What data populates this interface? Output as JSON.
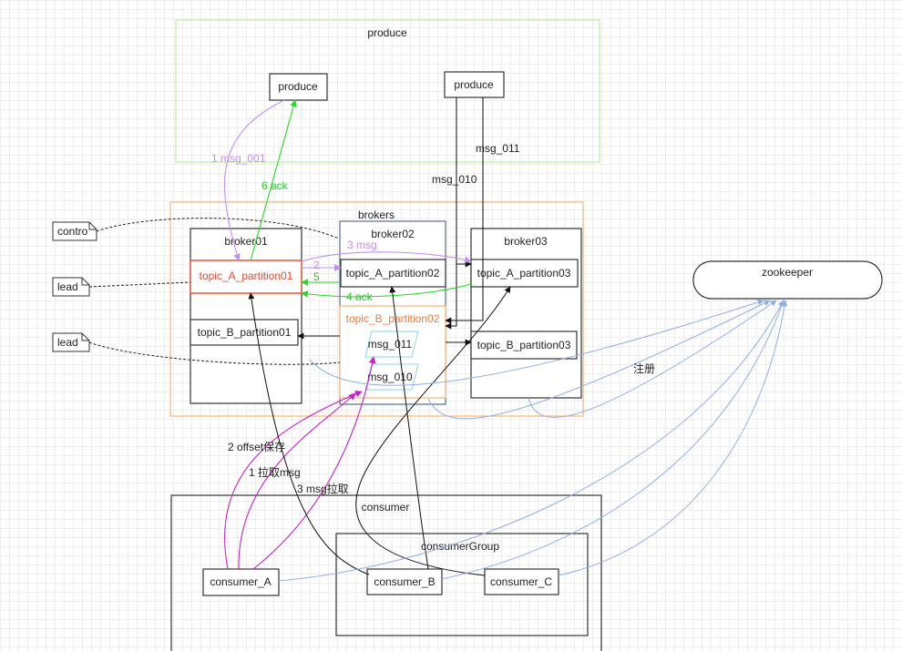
{
  "produce_group": {
    "title": "produce"
  },
  "producers": {
    "left": "produce",
    "right": "produce"
  },
  "brokers": {
    "title": "brokers",
    "broker01": {
      "title": "broker01",
      "partition_a": "topic_A_partition01",
      "partition_b": "topic_B_partition01"
    },
    "broker02": {
      "title": "broker02",
      "partition_a": "topic_A_partition02",
      "partition_b": "topic_B_partition02",
      "msgs": [
        "msg_011",
        "msg_010"
      ]
    },
    "broker03": {
      "title": "broker03",
      "partition_a": "topic_A_partition03",
      "partition_b": "topic_B_partition03"
    }
  },
  "notes": {
    "contro": "contro",
    "lead1": "lead",
    "lead2": "lead"
  },
  "zookeeper": {
    "title": "zookeeper"
  },
  "consumer": {
    "title": "consumer",
    "group_title": "consumerGroup",
    "consumer_a": "consumer_A",
    "consumer_b": "consumer_B",
    "consumer_c": "consumer_C"
  },
  "edge_labels": {
    "msg_001": "1 msg_001",
    "ack6": "6 ack",
    "msg_010": "msg_010",
    "msg_011": "msg_011",
    "msg3": "3 msg",
    "step2": "2",
    "step5": "5",
    "ack4": "4 ack",
    "register": "注册",
    "offset_save": "2 offset保存",
    "pull_msg": "1 拉取msg",
    "msg_pull3": "3 msg拉取"
  },
  "colors": {
    "purple": "#c58cf5",
    "green": "#22dd22",
    "magenta": "#c81ec8",
    "blue": "#8fb0e8",
    "orange_border": "#f5b47a",
    "red_text": "#e8482a"
  }
}
